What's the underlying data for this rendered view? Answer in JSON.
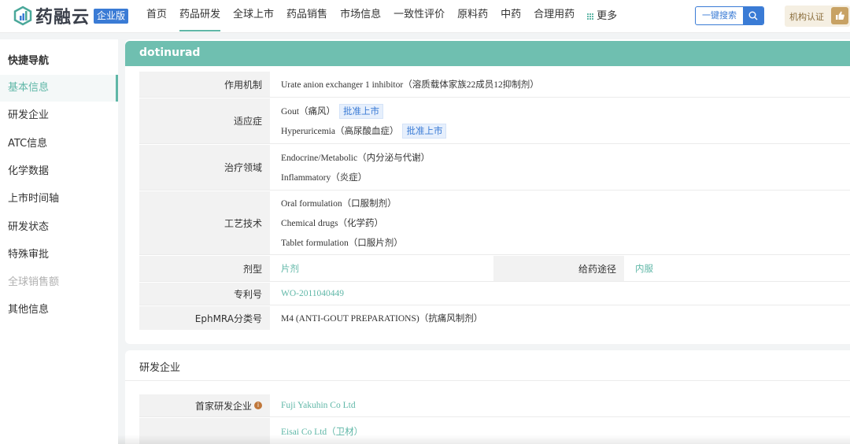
{
  "brand": {
    "name": "药融云",
    "edition": "企业版"
  },
  "nav": {
    "items": [
      "首页",
      "药品研发",
      "全球上市",
      "药品销售",
      "市场信息",
      "一致性评价",
      "原料药",
      "中药",
      "合理用药"
    ],
    "active_index": 1,
    "more_label": "更多",
    "search_label": "一键搜索",
    "cert_label": "机构认证"
  },
  "sidebar": {
    "title": "快捷导航",
    "items": [
      {
        "label": "基本信息",
        "state": "active"
      },
      {
        "label": "研发企业",
        "state": "normal"
      },
      {
        "label": "ATC信息",
        "state": "normal"
      },
      {
        "label": "化学数据",
        "state": "normal"
      },
      {
        "label": "上市时间轴",
        "state": "normal"
      },
      {
        "label": "研发状态",
        "state": "normal"
      },
      {
        "label": "特殊审批",
        "state": "normal"
      },
      {
        "label": "全球销售额",
        "state": "disabled"
      },
      {
        "label": "其他信息",
        "state": "normal"
      }
    ]
  },
  "drug": {
    "name": "dotinurad",
    "mechanism_label": "作用机制",
    "mechanism": "Urate anion exchanger 1 inhibitor（溶质载体家族22成员12抑制剂）",
    "indication_label": "适应症",
    "indications": [
      {
        "text": "Gout（痛风）",
        "tag": "批准上市"
      },
      {
        "text": "Hyperuricemia（高尿酸血症）",
        "tag": "批准上市"
      }
    ],
    "therapy_label": "治疗领域",
    "therapy": [
      "Endocrine/Metabolic（内分泌与代谢）",
      "Inflammatory（炎症）"
    ],
    "tech_label": "工艺技术",
    "tech": [
      "Oral formulation（口服制剂）",
      "Chemical drugs（化学药）",
      "Tablet formulation（口服片剂）"
    ],
    "dosage_label": "剂型",
    "dosage": "片剂",
    "route_label": "给药途径",
    "route": "内服",
    "patent_label": "专利号",
    "patent": "WO-2011040449",
    "ephmra_label": "EphMRA分类号",
    "ephmra": "M4 (ANTI-GOUT PREPARATIONS)（抗痛风制剂）"
  },
  "rd": {
    "title": "研发企业",
    "first_label": "首家研发企业",
    "info_icon": "i",
    "companies": [
      "Fuji Yakuhin Co Ltd",
      "Eisai Co Ltd（卫材）"
    ]
  },
  "colors": {
    "accent": "#5fb7a7",
    "header": "#6fbfb0",
    "brand_blue": "#3a7bd5",
    "tag_bg": "#e6effc"
  }
}
